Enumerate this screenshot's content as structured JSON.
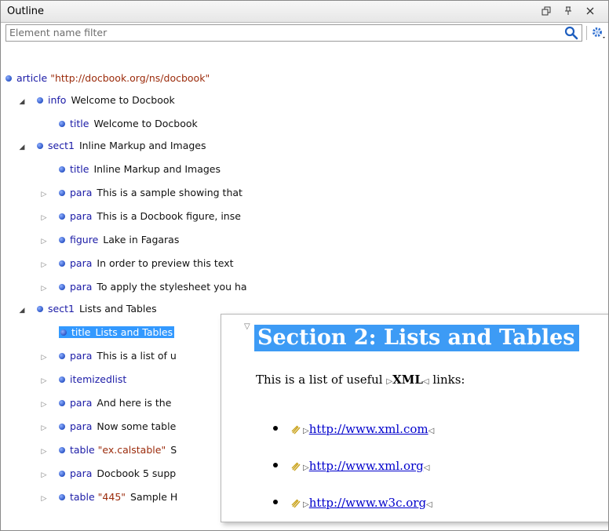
{
  "panel": {
    "title": "Outline"
  },
  "filter": {
    "placeholder": "Element name filter",
    "value": ""
  },
  "tree": [
    {
      "tag": "article",
      "attr": "\"http://docbook.org/ns/docbook\"",
      "text": "",
      "twisty": ""
    },
    {
      "tag": "info",
      "attr": "",
      "text": "Welcome to Docbook",
      "twisty": "expanded"
    },
    {
      "tag": "title",
      "attr": "",
      "text": "Welcome to Docbook",
      "twisty": ""
    },
    {
      "tag": "sect1",
      "attr": "",
      "text": "Inline Markup and Images",
      "twisty": "expanded"
    },
    {
      "tag": "title",
      "attr": "",
      "text": "Inline Markup and Images",
      "twisty": ""
    },
    {
      "tag": "para",
      "attr": "",
      "text": "This is a sample showing that",
      "twisty": "collapsed"
    },
    {
      "tag": "para",
      "attr": "",
      "text": "This is a Docbook figure, inse",
      "twisty": "collapsed"
    },
    {
      "tag": "figure",
      "attr": "",
      "text": "Lake in Fagaras",
      "twisty": "collapsed"
    },
    {
      "tag": "para",
      "attr": "",
      "text": "In order to preview this text",
      "twisty": "collapsed"
    },
    {
      "tag": "para",
      "attr": "",
      "text": "To apply the stylesheet you ha",
      "twisty": "collapsed"
    },
    {
      "tag": "sect1",
      "attr": "",
      "text": "Lists and Tables",
      "twisty": "expanded"
    },
    {
      "tag": "title",
      "attr": "",
      "text": "Lists and Tables",
      "twisty": "",
      "selected": true
    },
    {
      "tag": "para",
      "attr": "",
      "text": "This is a list of u",
      "twisty": "collapsed"
    },
    {
      "tag": "itemizedlist",
      "attr": "",
      "text": "",
      "twisty": "collapsed"
    },
    {
      "tag": "para",
      "attr": "",
      "text": "And here is the",
      "twisty": "collapsed"
    },
    {
      "tag": "para",
      "attr": "",
      "text": "Now some table",
      "twisty": "collapsed"
    },
    {
      "tag": "table",
      "attr": "\"ex.calstable\"",
      "text": "S",
      "twisty": "collapsed"
    },
    {
      "tag": "para",
      "attr": "",
      "text": "Docbook 5 supp",
      "twisty": "collapsed"
    },
    {
      "tag": "table",
      "attr": "\"445\"",
      "text": "Sample H",
      "twisty": "collapsed"
    }
  ],
  "preview": {
    "heading": "Section 2: Lists and Tables",
    "para_prefix": "This is a list of useful",
    "para_bold": "XML",
    "para_suffix": "links:",
    "links": [
      "http://www.xml.com",
      "http://www.xml.org",
      "http://www.w3c.org"
    ]
  }
}
